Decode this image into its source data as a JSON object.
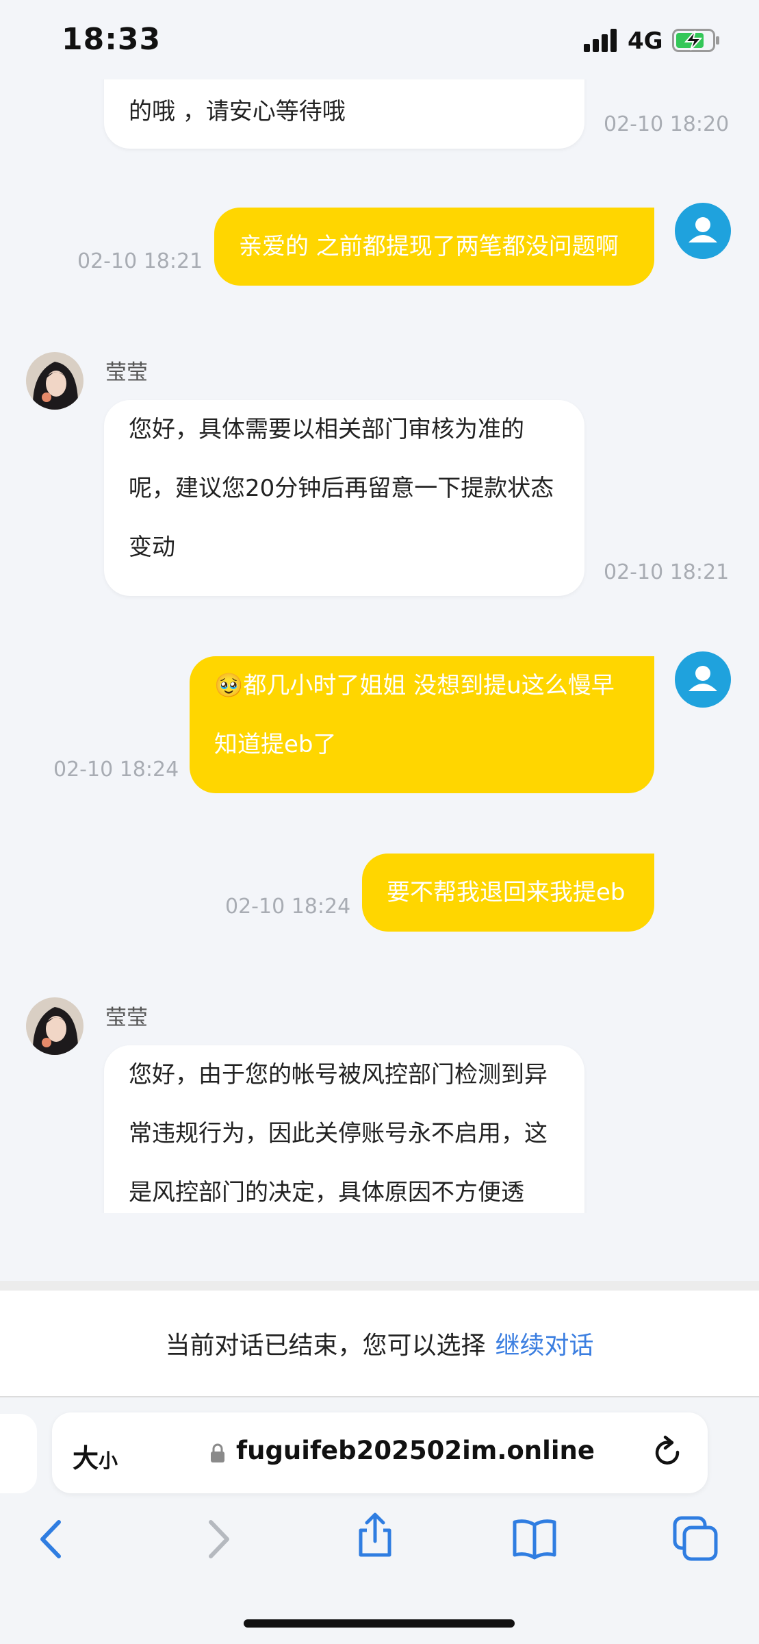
{
  "status": {
    "time": "18:33",
    "network": "4G"
  },
  "messages": [
    {
      "dir": "in",
      "text": "的哦 ，请安心等待哦",
      "time": "02-10 18:20"
    },
    {
      "dir": "out",
      "text": "亲爱的 之前都提现了两笔都没问题啊",
      "time": "02-10 18:21"
    },
    {
      "dir": "in",
      "sender": "莹莹",
      "text": "您好，具体需要以相关部门审核为准的呢，建议您20分钟后再留意一下提款状态变动",
      "time": "02-10 18:21"
    },
    {
      "dir": "out",
      "emoji": "🥹",
      "text": "都几小时了姐姐 没想到提u这么慢早知道提eb了",
      "time": "02-10 18:24"
    },
    {
      "dir": "out",
      "text": "要不帮我退回来我提eb",
      "time": "02-10 18:24"
    },
    {
      "dir": "in",
      "sender": "莹莹",
      "text": "您好，由于您的帐号被风控部门检测到异常违规行为，因此关停账号永不启用，这是风控部门的决定，具体原因不方便透"
    }
  ],
  "ended": {
    "text": "当前对话已结束，您可以选择",
    "link": "继续对话"
  },
  "browser": {
    "aa_big": "大",
    "aa_small": "小",
    "url": "fuguifeb202502im.online"
  },
  "colors": {
    "outgoing_bubble": "#ffd600",
    "link": "#3b7ee0",
    "user_avatar": "#1fa2dd"
  },
  "icons": [
    "signal-icon",
    "battery-charging-icon",
    "lock-icon",
    "reload-icon",
    "back-icon",
    "forward-icon",
    "share-icon",
    "bookmarks-icon",
    "tabs-icon"
  ]
}
